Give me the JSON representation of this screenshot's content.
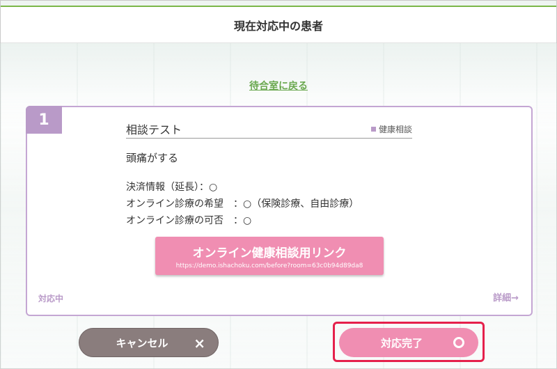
{
  "header": {
    "title": "現在対応中の患者"
  },
  "back_link": {
    "label": "待合室に戻る"
  },
  "card": {
    "number": "1",
    "title": "相談テスト",
    "category": "健康相談",
    "symptom": "頭痛がする",
    "info": [
      "決済情報（延長）：○",
      "オンライン診療の希望　：○（保険診療、自由診療）",
      "オンライン診療の可否　：○"
    ],
    "link_button": {
      "label": "オンライン健康相談用リンク",
      "url": "https://demo.ishachoku.com/before?room=63c0b94d89da8"
    },
    "status": "対応中",
    "details": "詳細→"
  },
  "buttons": {
    "cancel": {
      "label": "キャンセル",
      "icon": "×"
    },
    "complete": {
      "label": "対応完了"
    }
  },
  "colors": {
    "accent_green": "#7ab648",
    "card_purple": "#b99ac8",
    "pink": "#f08eb2",
    "cancel_gray": "#8a7d7d",
    "highlight_red": "#e5204b"
  }
}
